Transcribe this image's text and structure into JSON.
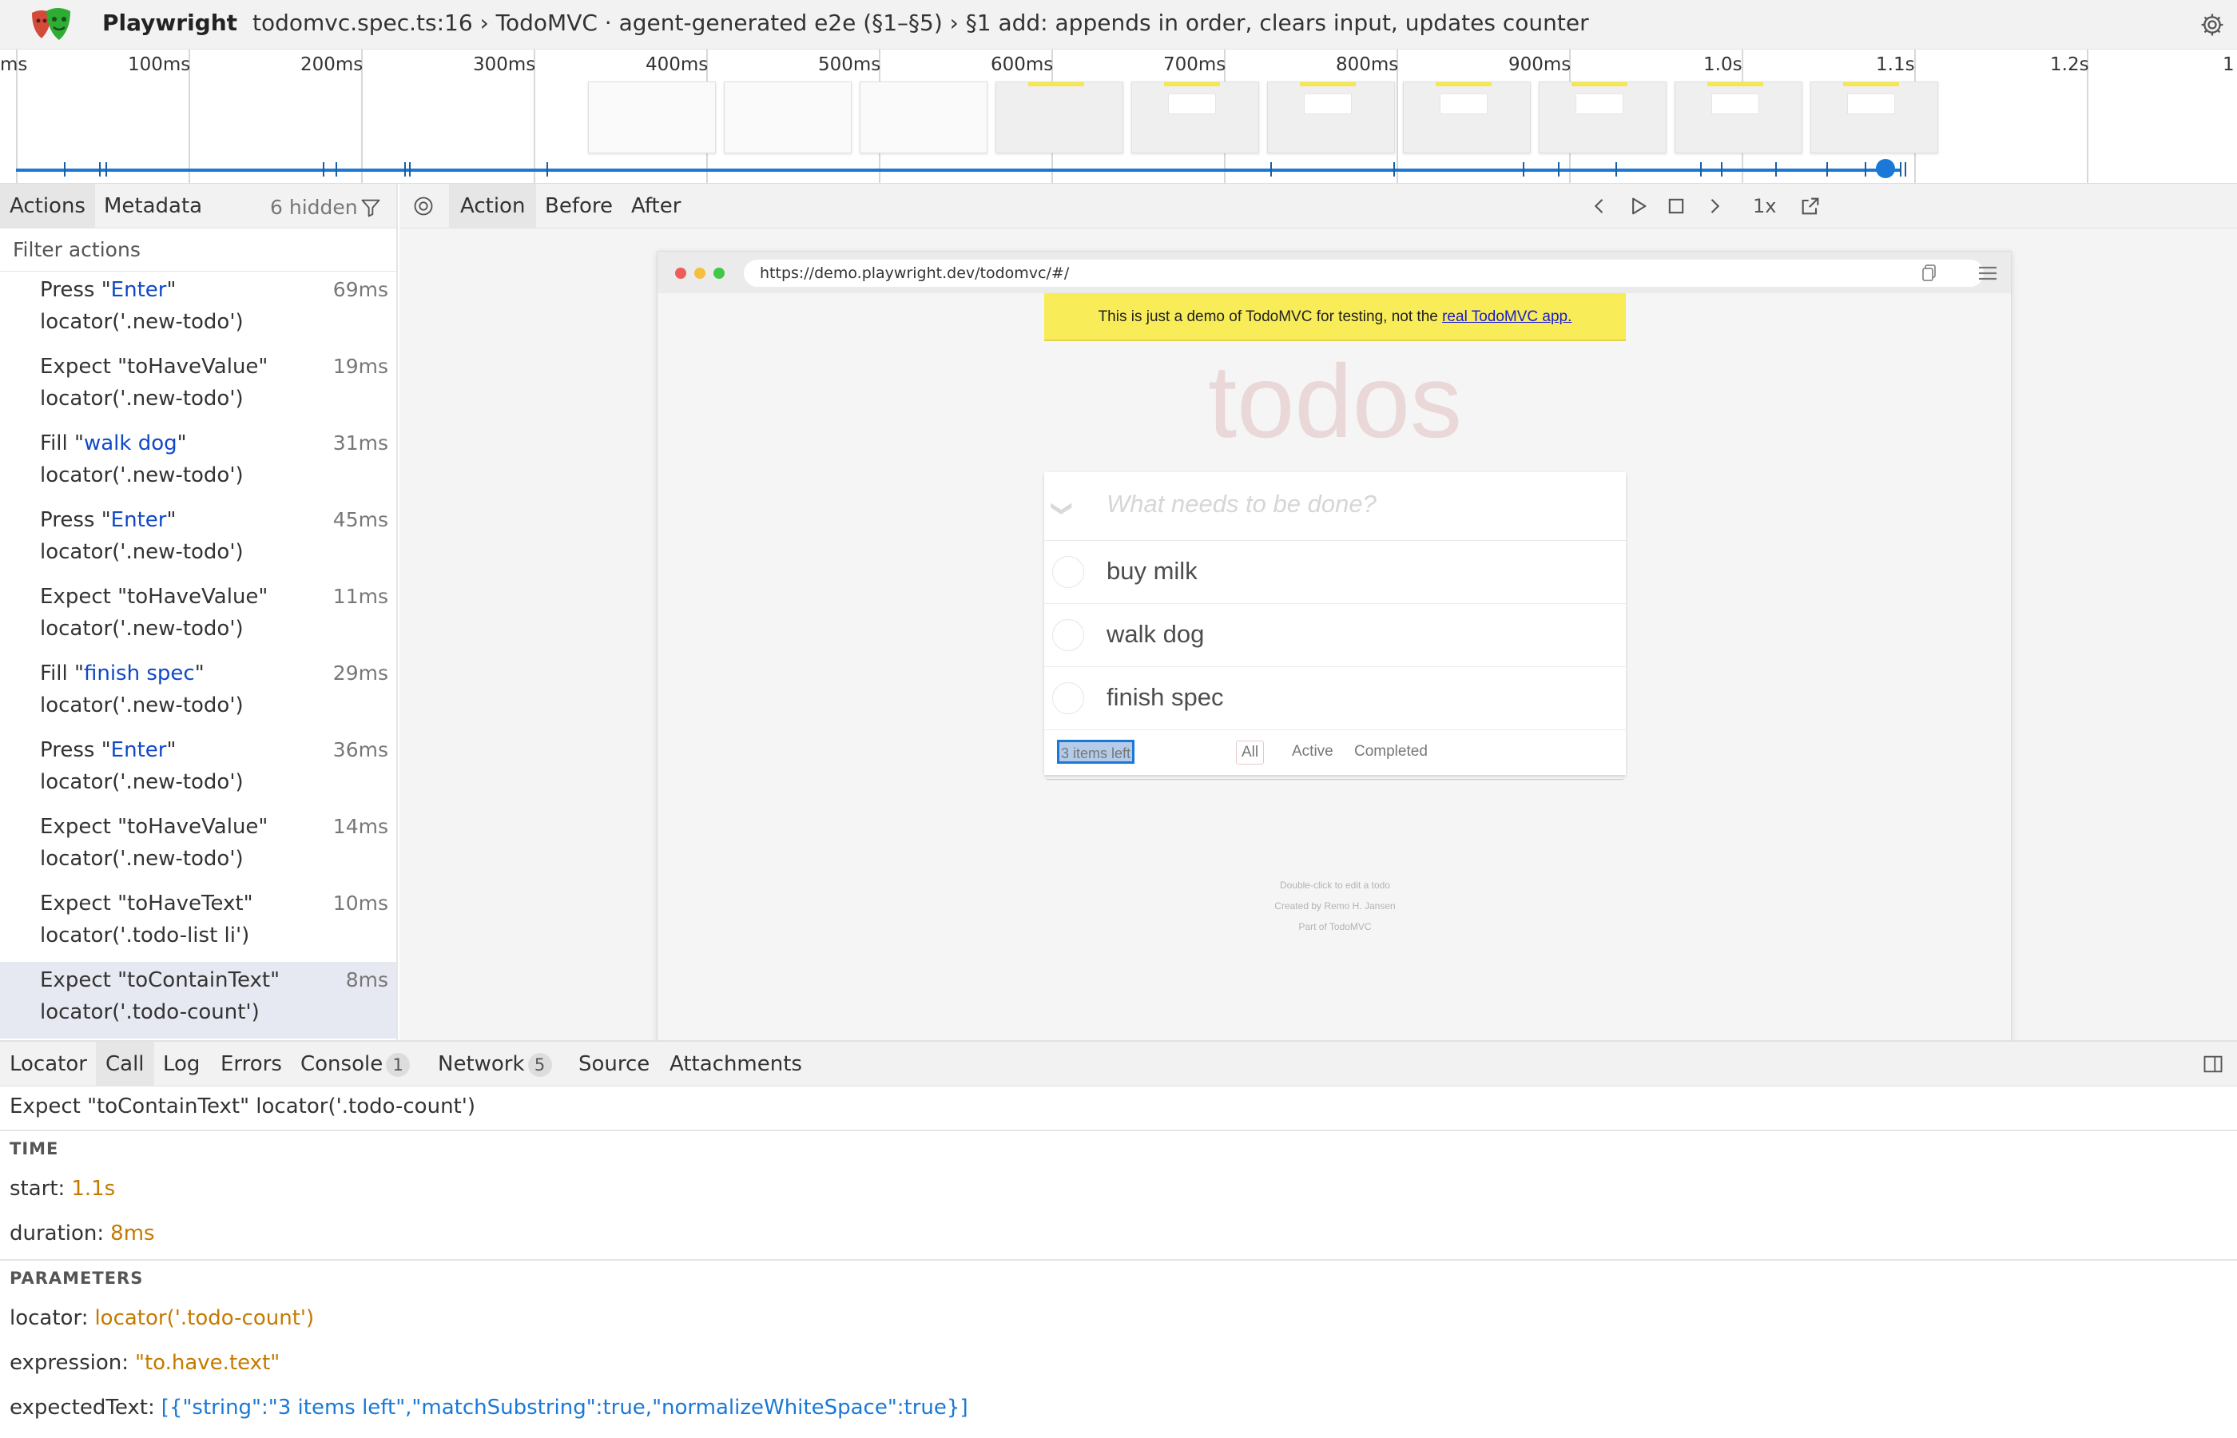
{
  "header": {
    "app_name": "Playwright",
    "title": "todomvc.spec.ts:16 › TodoMVC · agent-generated e2e (§1–§5) › §1 add: appends in order, clears input, updates counter"
  },
  "timeline": {
    "ticks": [
      "ms",
      "100ms",
      "200ms",
      "300ms",
      "400ms",
      "500ms",
      "600ms",
      "700ms",
      "800ms",
      "900ms",
      "1.0s",
      "1.1s",
      "1.2s",
      "1"
    ]
  },
  "sidebar": {
    "tabs": [
      "Actions",
      "Metadata"
    ],
    "hidden_count": "6 hidden",
    "filter_placeholder": "Filter actions",
    "actions": [
      {
        "verb": "Press",
        "value": "Enter",
        "locator": "locator('.new-todo')",
        "duration": "69ms"
      },
      {
        "verb": "Expect",
        "value": "toHaveValue",
        "locator": "locator('.new-todo')",
        "duration": "19ms"
      },
      {
        "verb": "Fill",
        "value": "walk dog",
        "locator": "locator('.new-todo')",
        "duration": "31ms"
      },
      {
        "verb": "Press",
        "value": "Enter",
        "locator": "locator('.new-todo')",
        "duration": "45ms"
      },
      {
        "verb": "Expect",
        "value": "toHaveValue",
        "locator": "locator('.new-todo')",
        "duration": "11ms"
      },
      {
        "verb": "Fill",
        "value": "finish spec",
        "locator": "locator('.new-todo')",
        "duration": "29ms"
      },
      {
        "verb": "Press",
        "value": "Enter",
        "locator": "locator('.new-todo')",
        "duration": "36ms"
      },
      {
        "verb": "Expect",
        "value": "toHaveValue",
        "locator": "locator('.new-todo')",
        "duration": "14ms"
      },
      {
        "verb": "Expect",
        "value": "toHaveText",
        "locator": "locator('.todo-list li')",
        "duration": "10ms"
      },
      {
        "verb": "Expect",
        "value": "toContainText",
        "locator": "locator('.todo-count')",
        "duration": "8ms"
      }
    ]
  },
  "main": {
    "tabs": [
      "Action",
      "Before",
      "After"
    ],
    "speed": "1x"
  },
  "browser": {
    "url": "https://demo.playwright.dev/todomvc/#/",
    "banner_text": "This is just a demo of TodoMVC for testing, not the ",
    "banner_link": "real TodoMVC app.",
    "app_title": "todos",
    "toggle_all": "❯",
    "input_placeholder": "What needs to be done?",
    "todos": [
      "buy milk",
      "walk dog",
      "finish spec"
    ],
    "count": "3 items left",
    "filters": [
      "All",
      "Active",
      "Completed"
    ],
    "info": [
      "Double-click to edit a todo",
      "Created by Remo H. Jansen",
      "Part of TodoMVC"
    ]
  },
  "bottom": {
    "tabs": [
      "Locator",
      "Call",
      "Log",
      "Errors",
      "Console",
      "Network",
      "Source",
      "Attachments"
    ],
    "console_badge": "1",
    "network_badge": "5",
    "call_title": "Expect \"toContainText\" locator('.todo-count')",
    "time_header": "TIME",
    "start_label": "start:",
    "start_value": "1.1s",
    "duration_label": "duration:",
    "duration_value": "8ms",
    "params_header": "PARAMETERS",
    "locator_label": "locator:",
    "locator_value": "locator('.todo-count')",
    "expression_label": "expression:",
    "expression_value": "\"to.have.text\"",
    "expected_label": "expectedText:",
    "expected_value": "[{\"string\":\"3 items left\",\"matchSubstring\":true,\"normalizeWhiteSpace\":true}]"
  },
  "colors": {
    "accent": "#1a78d6",
    "value_blue": "#1048c8",
    "param_orange": "#c47a00",
    "banner_yellow": "#f8ec58",
    "selected_row": "#e6e8f2"
  }
}
